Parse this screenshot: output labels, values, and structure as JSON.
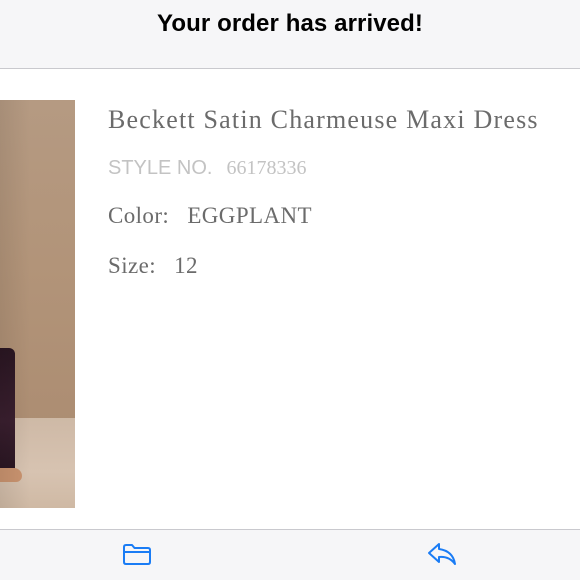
{
  "header": {
    "title": "Your order has arrived!"
  },
  "product": {
    "name": "Beckett Satin Charmeuse Maxi Dress",
    "style_label": "STYLE NO.",
    "style_number": "66178336",
    "color_label": "Color:",
    "color_value": "EGGPLANT",
    "size_label": "Size:",
    "size_value": "12",
    "image": "product-photo-dress"
  },
  "toolbar": {
    "folder_icon": "folder-icon",
    "reply_icon": "reply-icon",
    "icon_color": "#1a7cf5"
  }
}
